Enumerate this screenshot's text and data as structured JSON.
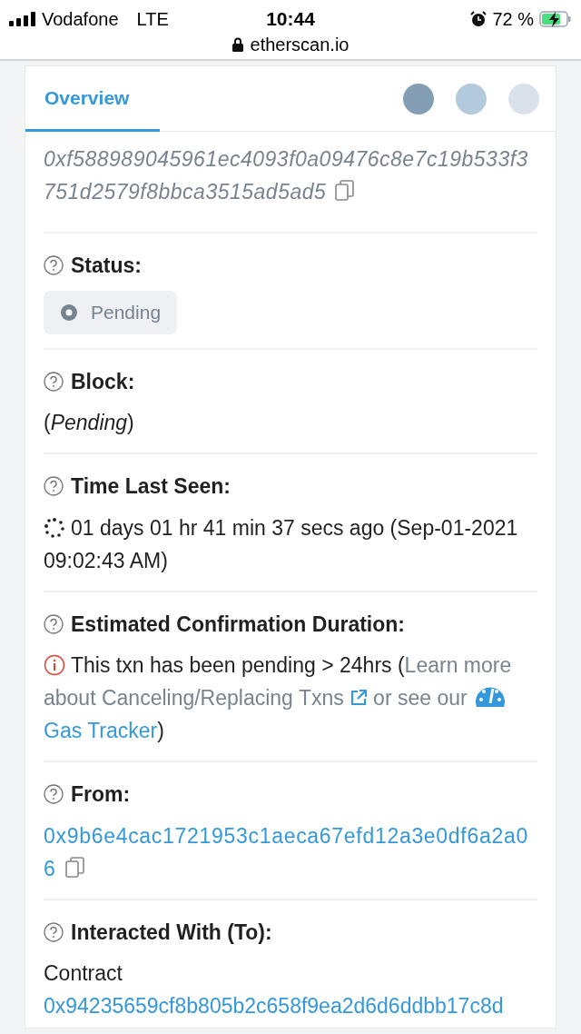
{
  "status_bar": {
    "carrier": "Vodafone",
    "network": "LTE",
    "time": "10:44",
    "battery": "72 %",
    "url": "etherscan.io"
  },
  "tabs": [
    {
      "label": "Overview",
      "selected": true
    }
  ],
  "sections": [
    {
      "kind": "hash",
      "value": "0xf588989045961ec4093f0a09476c8e7c19b533f3751d2579f8bbca3515ad5ad5"
    },
    {
      "kind": "status",
      "label": "Status:",
      "badge": "Pending"
    },
    {
      "kind": "text",
      "label": "Block:",
      "value": "(*Pending*)"
    },
    {
      "kind": "time",
      "label": "Time Last Seen:",
      "value": "01 days 01 hr 41 min 37 secs ago (Sep-01-2021 09:02:43 AM)"
    },
    {
      "kind": "notice",
      "label": "Estimated Confirmation Duration:",
      "text": "This txn has been pending > 24hrs (",
      "link": "Learn more about Canceling/Replacing Txns",
      "middle": " or see our ",
      "link2": "Gas Tracker",
      "end": ")"
    },
    {
      "kind": "address",
      "label": "From:",
      "value": "0x9b6e4cac1721953c1aeca67efd12a3e0df6a2a06"
    },
    {
      "kind": "contract",
      "label": "Interacted With (To):",
      "prefix": "Contract",
      "value": "0x94235659cf8b805b2c658f9ea2d6d6ddbb17c8d"
    }
  ]
}
